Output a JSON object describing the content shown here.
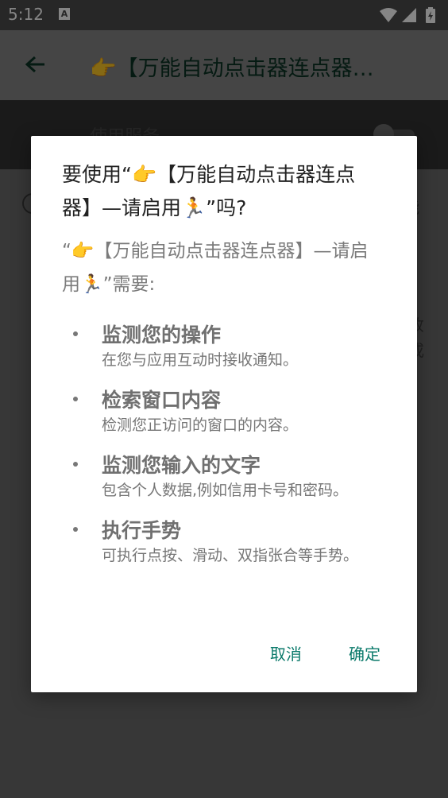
{
  "status_bar": {
    "time": "5:12",
    "notification_glyph": "A",
    "icons": [
      "wifi-icon",
      "signal-icon",
      "battery-charging-icon"
    ]
  },
  "app_bar": {
    "back_icon": "arrow-back-icon",
    "title": "👉【万能自动点击器连点器…"
  },
  "settings": {
    "service_label": "使用服务",
    "toggle_on": false,
    "edge_text": [
      "能",
      "收",
      "或"
    ]
  },
  "dialog": {
    "title": "要使用“👉【万能自动点击器连点器】—请启用🏃”吗?",
    "description": "“👉【万能自动点击器连点器】—请启用🏃”需要:",
    "permissions": [
      {
        "title": "监测您的操作",
        "desc": "在您与应用互动时接收通知。"
      },
      {
        "title": "检索窗口内容",
        "desc": "检测您正访问的窗口的内容。"
      },
      {
        "title": "监测您输入的文字",
        "desc": "包含个人数据,例如信用卡号和密码。"
      },
      {
        "title": "执行手势",
        "desc": "可执行点按、滑动、双指张合等手势。"
      }
    ],
    "cancel_label": "取消",
    "ok_label": "确定"
  },
  "colors": {
    "accent": "#0b7a6b",
    "scrim": "rgba(0,0,0,0.48)"
  }
}
